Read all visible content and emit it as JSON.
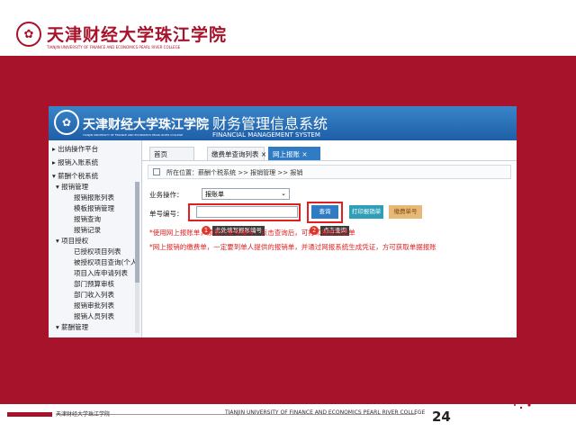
{
  "slide": {
    "logo_cn": "天津财经大学珠江学院",
    "logo_en": "TIANJIN UNIVERSITY OF FINANCE AND ECONOMICS PEARL RIVER COLLEGE",
    "footer_cn": "天津财经大学珠江学院",
    "footer_en": "TIANJIN UNIVERSITY OF FINANCE AND ECONOMICS PEARL RIVER COLLEGE",
    "page_number": "24",
    "brand_color": "#a6132a"
  },
  "app": {
    "school_cn": "天津财经大学珠江学院",
    "school_en": "TIANJIN UNIVERSITY OF FINANCE AND ECONOMICS PEARL RIVER COLLEGE",
    "title": "财务管理信息系统",
    "subtitle": "FINANCIAL MANAGEMENT SYSTEM",
    "accent_color": "#2f7bc4"
  },
  "sidebar": {
    "items": [
      {
        "label": "▸ 出纳操作平台"
      },
      {
        "label": "▸ 报销入账系统"
      },
      {
        "label": "▾ 薪酬个税系统"
      },
      {
        "label": "▾ 报销管理"
      },
      {
        "label": "报销报账列表"
      },
      {
        "label": "模板报销管理"
      },
      {
        "label": "报销查询"
      },
      {
        "label": "报销记录"
      },
      {
        "label": "▾ 项目授权"
      },
      {
        "label": "已授权项目列表"
      },
      {
        "label": "被授权项目查询(个人)"
      },
      {
        "label": "项目入库申请列表"
      },
      {
        "label": "部门预算审核"
      },
      {
        "label": "部门收入列表"
      },
      {
        "label": "报销审批列表"
      },
      {
        "label": "报销人员列表"
      },
      {
        "label": "▾ 薪酬管理"
      }
    ]
  },
  "tabs": [
    {
      "label": "首页"
    },
    {
      "label": "缴费单查询列表 ×"
    },
    {
      "label": "网上报账 ×"
    }
  ],
  "breadcrumb": "所在位置：薪酬个税系统 >> 报销管理 >> 报销",
  "form": {
    "type_label": "业务操作：",
    "type_value": "报账单",
    "number_label": "单号编号：",
    "number_placeholder": "",
    "query_button": "查询",
    "print_button": "打印报销单",
    "pay_button": "缴费单号"
  },
  "notes": {
    "line1": "*使用网上报账单，须录入单号编号，点击查询后，可打印报账信息单",
    "line2": "*网上报销的缴费单，一定要到单人提供的报销单，并通过网报系统生成凭证，方可获取单据报账"
  },
  "tooltips": {
    "tip1": "此处填写报账编号",
    "tip2": "点击查询",
    "badge1": "1",
    "badge2": "2"
  },
  "icons": {
    "seal": "university-seal-icon",
    "breadcrumb": "page-icon",
    "dropdown": "chevron-down-icon"
  }
}
